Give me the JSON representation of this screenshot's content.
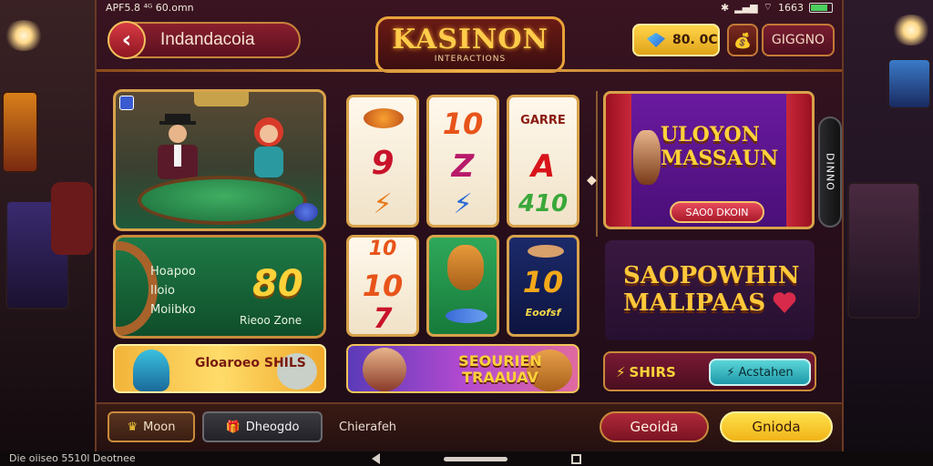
{
  "status": {
    "left": "APF5.8  ⁴ᴳ  60.omn",
    "right": "1663"
  },
  "header": {
    "back_label": "Indandacoia",
    "logo_title": "KASINON",
    "logo_subtitle": "INTERACTIONS",
    "coins": "80. 0C",
    "menu_label": "GIGGNO"
  },
  "left": {
    "bonus": {
      "labels": [
        "Hoapoo",
        "Iloio",
        "Moiibko"
      ],
      "value": "80",
      "sub": "Rieoo Zone"
    },
    "banner_text": "Gloaroeo SHILS"
  },
  "reels": {
    "r1": [
      "",
      "9",
      "⚡"
    ],
    "r2": [
      "10",
      "Z",
      "⚡"
    ],
    "r3": [
      "GARRE",
      "A",
      "410"
    ],
    "r4": [
      "10",
      "10",
      "7"
    ],
    "r6": [
      "10",
      "Eoofsf"
    ]
  },
  "middle_banner": "SEOURIEN TRAAUAV",
  "right": {
    "promo_title": "ULOYON MASSAUN",
    "promo_button": "SAO0 DKOIN",
    "side_tab": "DINNO",
    "promo2_title": "SAOPOWHIN MALIPAAS",
    "sharks": "SHIRS",
    "action_label": "Acstahen"
  },
  "bottom": {
    "btn1": "Moon",
    "btn2": "Dheogdo",
    "text": "Chierafeh",
    "cancel": "Geoida",
    "ok": "Gnioda"
  },
  "nav": {
    "left": "Die oiiseo 5510l   Deotnee"
  },
  "colors": {
    "gold": "#e8a23a",
    "green_felt": "#1f7a46",
    "accent_red": "#b02a3a",
    "accent_yellow": "#ffe04a",
    "accent_teal": "#5ad6d8"
  }
}
